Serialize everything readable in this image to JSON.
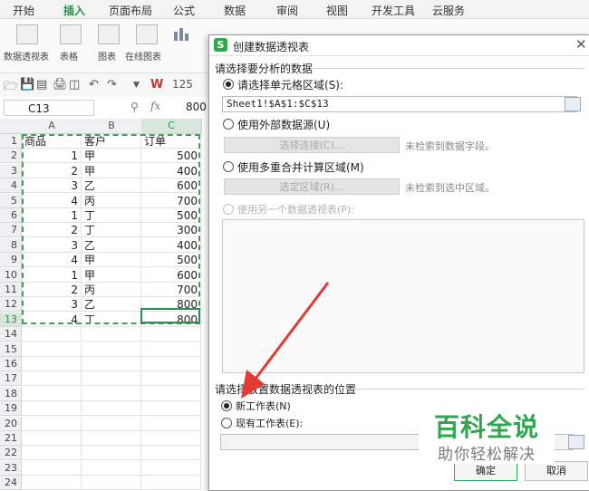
{
  "menu": [
    "开始",
    "插入",
    "页面布局",
    "公式",
    "数据",
    "审阅",
    "视图",
    "开发工具",
    "云服务"
  ],
  "ribbon": [
    "数据透视表",
    "表格",
    "图表",
    "在线图表"
  ],
  "zoom": "125",
  "namebox": "C13",
  "fx": "fx",
  "formula_value": "800",
  "columns": [
    "A",
    "B",
    "C"
  ],
  "rows": [
    "1",
    "2",
    "3",
    "4",
    "5",
    "6",
    "7",
    "8",
    "9",
    "10",
    "11",
    "12",
    "13",
    "14",
    "15",
    "16",
    "17",
    "18",
    "19",
    "20",
    "21",
    "22",
    "23",
    "24"
  ],
  "table": [
    [
      "商品",
      "客户",
      "订单"
    ],
    [
      "1",
      "甲",
      "500"
    ],
    [
      "2",
      "甲",
      "400"
    ],
    [
      "3",
      "乙",
      "600"
    ],
    [
      "4",
      "丙",
      "700"
    ],
    [
      "1",
      "丁",
      "500"
    ],
    [
      "2",
      "丁",
      "300"
    ],
    [
      "3",
      "乙",
      "400"
    ],
    [
      "4",
      "甲",
      "500"
    ],
    [
      "1",
      "甲",
      "600"
    ],
    [
      "2",
      "丙",
      "700"
    ],
    [
      "3",
      "乙",
      "800"
    ],
    [
      "4",
      "丁",
      "800"
    ]
  ],
  "dialog": {
    "title": "创建数据透视表",
    "section1": "请选择要分析的数据",
    "opt_range": "请选择单元格区域(S):",
    "range_value": "Sheet1!$A$1:$C$13",
    "opt_external": "使用外部数据源(U)",
    "btn_choose_conn": "选择连接(C)...",
    "hint_no_field": "未检索到数据字段。",
    "opt_multi": "使用多重合并计算区域(M)",
    "btn_choose_range": "选定区域(R)...",
    "hint_no_range": "未检索到选中区域。",
    "opt_other_pivot": "使用另一个数据透视表(P):",
    "section2": "请选择放置数据透视表的位置",
    "opt_new_sheet": "新工作表(N)",
    "opt_existing_sheet": "现有工作表(E):",
    "ok": "确定",
    "cancel": "取消"
  },
  "watermark": {
    "title": "百科全说",
    "subtitle": "助你轻松解决"
  },
  "colors": {
    "accent": "#2a8f4a",
    "arrow": "#e53935",
    "watermark": "#2ea84e"
  }
}
